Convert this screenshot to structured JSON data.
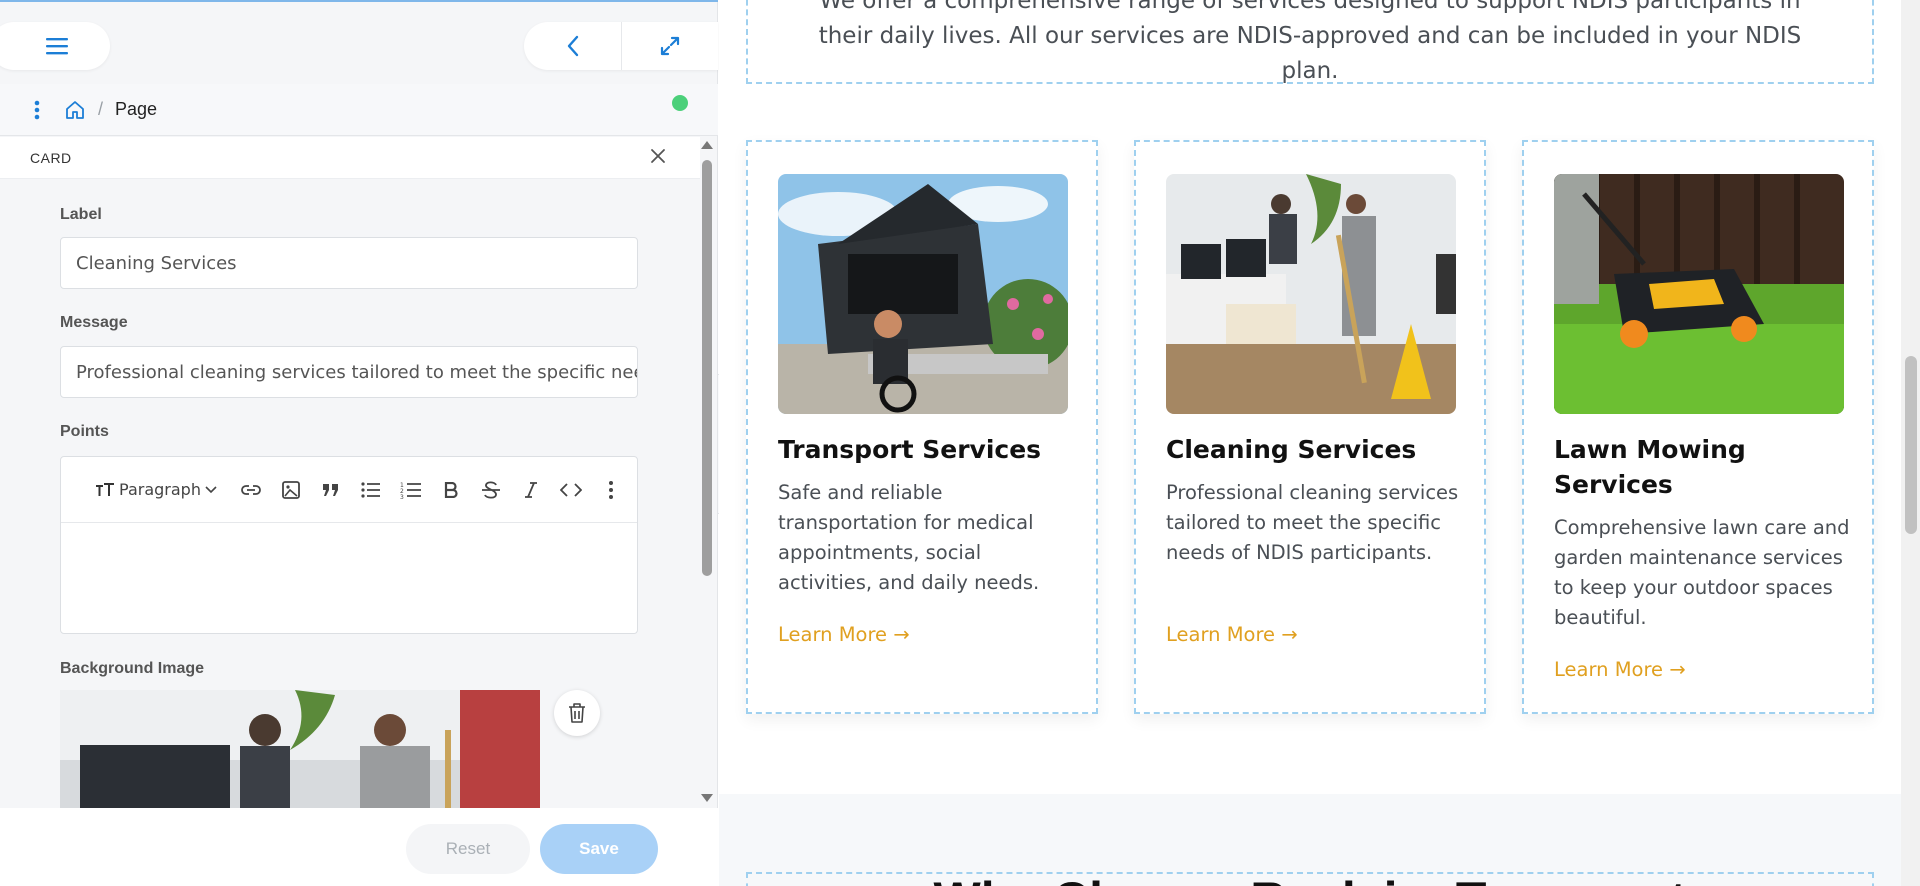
{
  "panel": {
    "breadcrumb": {
      "page": "Page"
    },
    "section_title": "CARD",
    "fields": {
      "label": {
        "label": "Label",
        "value": "Cleaning Services"
      },
      "message": {
        "label": "Message",
        "value": "Professional cleaning services tailored to meet the specific needs of NDIS participants."
      },
      "points": {
        "label": "Points",
        "paragraph_label": "Paragraph"
      },
      "background_image": {
        "label": "Background Image"
      }
    },
    "footer": {
      "reset": "Reset",
      "save": "Save"
    },
    "status_color": "#4cd07a"
  },
  "preview": {
    "intro_lines": [
      "We offer a comprehensive range of services designed to support NDIS participants in",
      "their daily lives. All our services are NDIS-approved and can be included in your NDIS",
      "plan."
    ],
    "services": [
      {
        "title": "Transport Services",
        "description": "Safe and reliable transportation for medical appointments, social activities, and daily needs.",
        "link": "Learn More →"
      },
      {
        "title": "Cleaning Services",
        "description": "Professional cleaning services tailored to meet the specific needs of NDIS participants.",
        "link": "Learn More →"
      },
      {
        "title": "Lawn Mowing Services",
        "description": "Comprehensive lawn care and garden maintenance services to keep your outdoor spaces beautiful.",
        "link": "Learn More →"
      }
    ],
    "next_heading": "Why Choose Reclaim Transport",
    "accent_color": "#e0a020",
    "outline_color": "#9fd0ef"
  }
}
